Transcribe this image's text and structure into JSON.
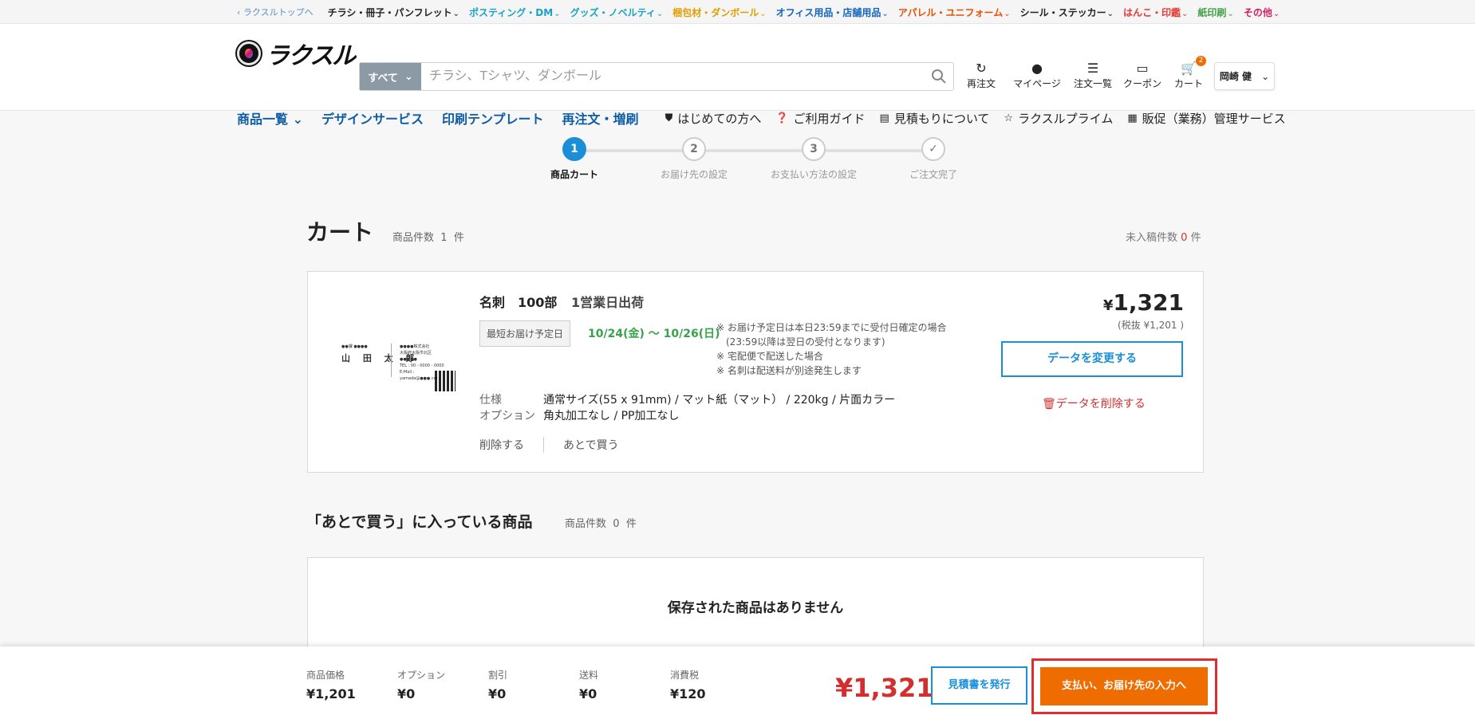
{
  "topbar": {
    "back_link": "ラクスルトップへ",
    "categories": [
      {
        "label": "チラシ・冊子・パンフレット",
        "color": "#222222"
      },
      {
        "label": "ポスティング・DM",
        "color": "#1aa1c8"
      },
      {
        "label": "グッズ・ノベルティ",
        "color": "#1aa1c8"
      },
      {
        "label": "梱包材・ダンボール",
        "color": "#e0a000"
      },
      {
        "label": "オフィス用品・店舗用品",
        "color": "#1565c0"
      },
      {
        "label": "アパレル・ユニフォーム",
        "color": "#e65100"
      },
      {
        "label": "シール・ステッカー",
        "color": "#222222"
      },
      {
        "label": "はんこ・印鑑",
        "color": "#e53935"
      },
      {
        "label": "紙印刷",
        "color": "#43a047"
      },
      {
        "label": "その他",
        "color": "#d81b60"
      }
    ]
  },
  "header": {
    "logo_text": "ラクスル",
    "search": {
      "category": "すべて",
      "placeholder": "チラシ、Tシャツ、ダンボール"
    },
    "icons": [
      {
        "label": "再注文",
        "icon": "refresh-icon"
      },
      {
        "label": "マイページ",
        "icon": "person-icon"
      },
      {
        "label": "注文一覧",
        "icon": "list-icon"
      },
      {
        "label": "クーポン",
        "icon": "coupon-icon"
      },
      {
        "label": "カート",
        "icon": "cart-icon",
        "badge": "2"
      }
    ],
    "user_name": "岡崎 健"
  },
  "nav": {
    "main": [
      "商品一覧",
      "デザインサービス",
      "印刷テンプレート",
      "再注文・増刷"
    ],
    "sub": [
      {
        "label": "はじめての方へ",
        "icon": "shield-icon"
      },
      {
        "label": "ご利用ガイド",
        "icon": "question-icon"
      },
      {
        "label": "見積もりについて",
        "icon": "document-icon"
      },
      {
        "label": "ラクスルプライム",
        "icon": "star-icon"
      },
      {
        "label": "販促（業務）管理サービス",
        "icon": "building-icon"
      }
    ]
  },
  "steps": [
    {
      "num": "1",
      "label": "商品カート",
      "active": true
    },
    {
      "num": "2",
      "label": "お届け先の設定",
      "active": false
    },
    {
      "num": "3",
      "label": "お支払い方法の設定",
      "active": false
    },
    {
      "num": "✓",
      "label": "ご注文完了",
      "active": false
    }
  ],
  "cart": {
    "title": "カート",
    "count_label": "商品件数",
    "count": "1",
    "count_unit": "件",
    "draft_label": "未入稿件数",
    "draft_count": "0",
    "draft_unit": "件"
  },
  "item": {
    "name": "名刺　100部",
    "shipping": "1営業日出荷",
    "delivery_tag": "最短お届け予定日",
    "delivery_date": "10/24(金) 〜 10/26(日)",
    "notes": [
      "※ お届け予定日は本日23:59までに受付日確定の場合",
      "　(23:59以降は翌日の受付となります)",
      "※ 宅配便で配送した場合",
      "※ 名刺は配送料が別途発生します"
    ],
    "spec_label": "仕様",
    "spec_value": "通常サイズ(55 x 91mm) / マット紙（マット） / 220kg / 片面カラー",
    "option_label": "オプション",
    "option_value": "角丸加工なし / PP加工なし",
    "delete_label": "削除する",
    "later_label": "あとで買う",
    "price_yen": "¥",
    "price": "1,321",
    "price_tax": "(税抜 ¥1,201 )",
    "change_data": "データを変更する",
    "delete_data": "データを削除する",
    "card_preview": {
      "name": "山 田 太 郎",
      "pre": "●●課 ●●●●",
      "info": [
        "●●●●株式会社",
        "大阪府大阪市北区●●●●●",
        "TEL : 00 - 0000 - 0000",
        "E-Mail : yamada@●●●.com"
      ]
    }
  },
  "later": {
    "title": "「あとで買う」に入っている商品",
    "count_label": "商品件数",
    "count": "0",
    "count_unit": "件",
    "empty": "保存された商品はありません"
  },
  "footer": {
    "items": [
      {
        "label": "商品価格",
        "value": "¥1,201"
      },
      {
        "label": "オプション",
        "value": "¥0"
      },
      {
        "label": "割引",
        "value": "¥0"
      },
      {
        "label": "送料",
        "value": "¥0"
      },
      {
        "label": "消費税",
        "value": "¥120"
      }
    ],
    "total": "¥1,321",
    "quote_button": "見積書を発行",
    "next_button": "支払い、お届け先の入力へ"
  }
}
